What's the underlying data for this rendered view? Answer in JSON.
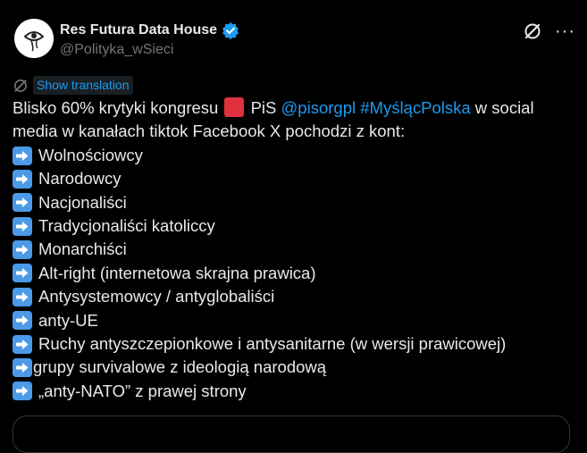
{
  "author": {
    "display_name": "Res Futura Data House",
    "handle": "@Polityka_wSieci",
    "avatar_text": "Res Futura",
    "verified": true
  },
  "translate": {
    "label": "Show translation"
  },
  "post": {
    "line1_before": "Blisko 60% krytyki kongresu",
    "line1_after": "PiS",
    "mention": "@pisorgpl",
    "hashtag": "#MyślącPolska",
    "line1_tail": "w social",
    "line2": "media w kanałach tiktok Facebook X pochodzi z kont:",
    "items": [
      "Wolnościowcy",
      "Narodowcy",
      "Nacjonaliści",
      "Tradycjonaliści katoliccy",
      "Monarchiści",
      "Alt-right (internetowa skrajna prawica)",
      "Antysystemowcy / antyglobaliści",
      "anty-UE",
      "Ruchy antyszczepionkowe i antysanitarne (w wersji prawicowej)",
      "grupy survivalowe z ideologią narodową",
      "„anty-NATO” z prawej strony"
    ]
  },
  "colors": {
    "link": "#1d9bf0",
    "text": "#e7e9ea",
    "muted": "#71767b",
    "flag": "#e0313e",
    "arrow_bg": "#4b9ae8"
  }
}
